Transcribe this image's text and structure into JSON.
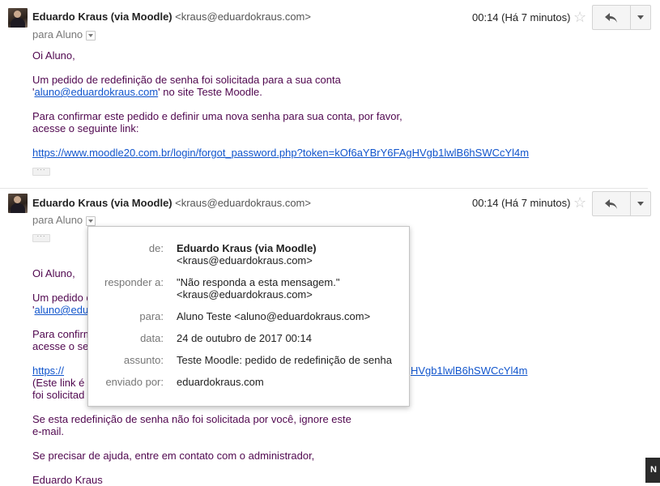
{
  "email1": {
    "sender_name": "Eduardo Kraus (via Moodle)",
    "sender_email": "<kraus@eduardokraus.com>",
    "time": "00:14 (Há 7 minutos)",
    "to": "para Aluno",
    "greeting": "Oi Aluno,",
    "p1_line1": "Um pedido de redefinição de senha foi solicitada para a sua conta",
    "p1_quote_open": "'",
    "p1_email": "aluno@eduardokraus.com",
    "p1_rest": "' no site Teste Moodle.",
    "p2_line1": "Para confirmar este pedido e definir uma nova senha para sua conta, por favor,",
    "p2_line2": "acesse o seguinte link:",
    "link": "https://www.moodle20.com.br/login/forgot_password.php?token=kOf6aYBrY6FAgHVgb1lwlB6hSWCcYl4m"
  },
  "email2": {
    "sender_name": "Eduardo Kraus (via Moodle)",
    "sender_email": "<kraus@eduardokraus.com>",
    "time": "00:14 (Há 7 minutos)",
    "to": "para Aluno",
    "greeting": "Oi Aluno,",
    "p1_line1_visible": "Um pedido d",
    "p1_line2_quote": "'",
    "p1_line2_visible": "aluno@edu",
    "p2_line1_visible": "Para confirm",
    "p2_line2_visible": "acesse o se",
    "link_left_visible": "https://",
    "link_right_visible": "HVgb1lwlB6hSWCcYl4m",
    "note_line1_visible": "(Este link é",
    "note_line2_visible": "foi solicitad",
    "p3_line1": "Se esta redefinição de senha não foi solicitada por você, ignore este",
    "p3_line2": "e-mail.",
    "p4": "Se precisar de ajuda, entre em contato com o administrador,",
    "signature": "Eduardo Kraus"
  },
  "details_popup": {
    "from_label": "de:",
    "from_name": "Eduardo Kraus (via Moodle)",
    "from_email": "<kraus@eduardokraus.com>",
    "reply_label": "responder a:",
    "reply_name": "\"Não responda a esta mensagem.\"",
    "reply_email": "<kraus@eduardokraus.com>",
    "to_label": "para:",
    "to_value": "Aluno Teste <aluno@eduardokraus.com>",
    "date_label": "data:",
    "date_value": "24 de outubro de 2017 00:14",
    "subject_label": "assunto:",
    "subject_value": "Teste Moodle: pedido de redefinição de senha",
    "sent_by_label": "enviado por:",
    "sent_by_value": "eduardokraus.com"
  },
  "corner_badge": "N",
  "icons": {
    "star": "star-icon",
    "reply": "reply-arrow-icon",
    "more": "chevron-down-icon",
    "expand": "ellipsis-icon",
    "details": "details-caret-icon"
  }
}
